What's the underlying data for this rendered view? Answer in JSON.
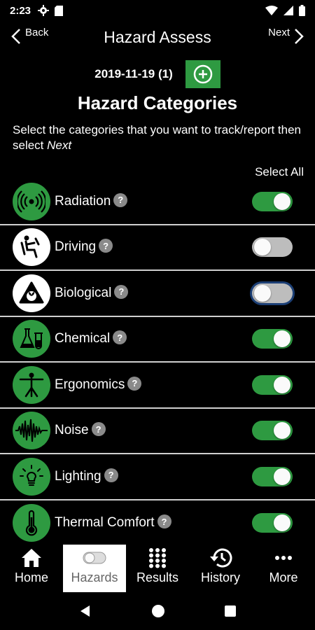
{
  "status_bar": {
    "time": "2:23"
  },
  "header": {
    "back_label": "Back",
    "title": "Hazard Assess",
    "next_label": "Next"
  },
  "assessment": {
    "date_label": "2019-11-19 (1)"
  },
  "section": {
    "title": "Hazard Categories",
    "instructions_prefix": "Select the categories that you want to track/report then select ",
    "instructions_emphasis": "Next",
    "select_all_label": "Select All"
  },
  "categories": [
    {
      "label": "Radiation",
      "icon": "radiation-icon",
      "enabled": true
    },
    {
      "label": "Driving",
      "icon": "driving-icon",
      "enabled": false
    },
    {
      "label": "Biological",
      "icon": "biological-icon",
      "enabled": false
    },
    {
      "label": "Chemical",
      "icon": "chemical-icon",
      "enabled": true
    },
    {
      "label": "Ergonomics",
      "icon": "ergonomics-icon",
      "enabled": true
    },
    {
      "label": "Noise",
      "icon": "noise-icon",
      "enabled": true
    },
    {
      "label": "Lighting",
      "icon": "lighting-icon",
      "enabled": true
    },
    {
      "label": "Thermal Comfort",
      "icon": "thermometer-icon",
      "enabled": true
    }
  ],
  "bottom_nav": [
    {
      "label": "Home",
      "icon": "home-icon",
      "active": false
    },
    {
      "label": "Hazards",
      "icon": "toggle-icon",
      "active": true
    },
    {
      "label": "Results",
      "icon": "grid-icon",
      "active": false
    },
    {
      "label": "History",
      "icon": "history-icon",
      "active": false
    },
    {
      "label": "More",
      "icon": "more-icon",
      "active": false
    }
  ],
  "colors": {
    "accent": "#2e9a41",
    "background": "#000000",
    "toggle_off": "#bdbdbd",
    "focus_ring": "#1c3f75"
  }
}
